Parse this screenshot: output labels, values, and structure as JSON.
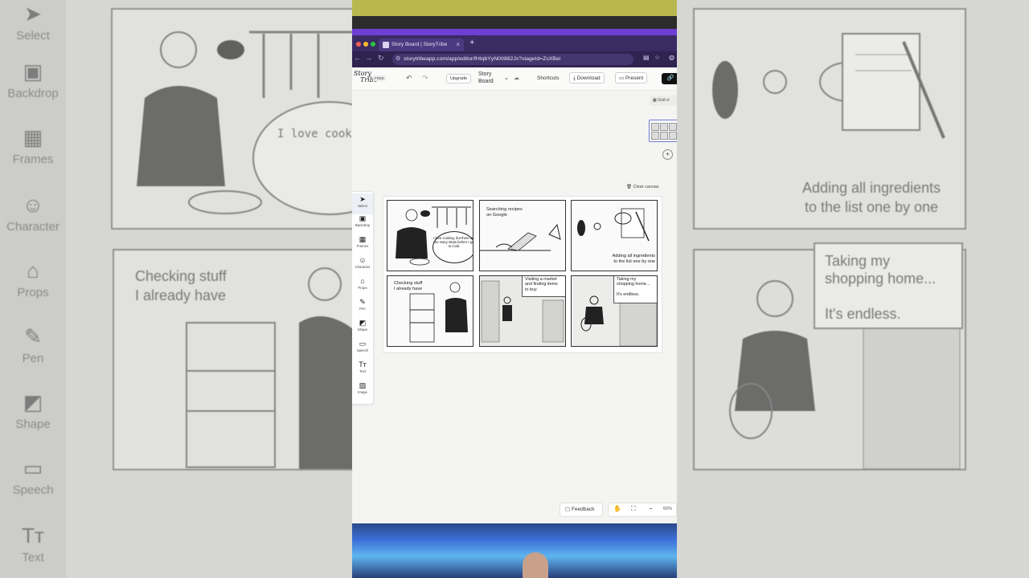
{
  "background_left": {
    "tools": [
      "Select",
      "Backdrop",
      "Frames",
      "Character",
      "Props",
      "Pen",
      "Shape",
      "Speech",
      "Text"
    ],
    "bubble_text": "I love cooking, but there are too many steps before I get to cook.",
    "panel_caption": "Checking stuff\nI already have"
  },
  "background_right": {
    "caption1": "Adding all ingredients\nto the list one by one",
    "caption2": "Taking my\nshopping home...\n\nIt's endless."
  },
  "browser": {
    "tab_title": "Story Board | StoryTribe",
    "url": "storytribeapp.com/app/editor/fHtqbYyNlXt882Jx?stageId=ZsXBei"
  },
  "header": {
    "logo_line1": "Story",
    "logo_line2": "Tribe",
    "free_badge": "FREE",
    "undo_icon": "undo-icon",
    "redo_icon": "redo-icon",
    "upgrade_label": "Upgrade",
    "doc_title": "Story\nBoard",
    "shortcuts_label": "Shortcuts",
    "download_label": "Download",
    "present_label": "Present"
  },
  "tools": [
    {
      "label": "Select",
      "icon": "cursor-icon",
      "glyph": "➤"
    },
    {
      "label": "Backdrop",
      "icon": "image-frame-icon",
      "glyph": "▣"
    },
    {
      "label": "Frames",
      "icon": "grid-icon",
      "glyph": "▦"
    },
    {
      "label": "Character",
      "icon": "face-icon",
      "glyph": "☺"
    },
    {
      "label": "Props",
      "icon": "sofa-icon",
      "glyph": "⌂"
    },
    {
      "label": "Pen",
      "icon": "pen-icon",
      "glyph": "✎"
    },
    {
      "label": "Shape",
      "icon": "shape-icon",
      "glyph": "◩"
    },
    {
      "label": "Speech",
      "icon": "speech-icon",
      "glyph": "▭"
    },
    {
      "label": "Text",
      "icon": "text-icon",
      "glyph": "Tт"
    },
    {
      "label": "Image",
      "icon": "photo-icon",
      "glyph": "▨"
    }
  ],
  "canvas": {
    "grid_view_label": "Grid vi",
    "clear_canvas_label": "Clear canvas",
    "panels": [
      {
        "caption": "",
        "bubble": "I love cooking, but there are too many steps before I get to cook."
      },
      {
        "caption": "Searching recipes\non Google"
      },
      {
        "caption": "Adding all ingredients\nto the list one by one"
      },
      {
        "caption": "Checking stuff\nI already have"
      },
      {
        "caption": "Visiting a market\nand finding items\nto buy"
      },
      {
        "caption": "Taking my\nshopping home...\n\nIt's endless."
      }
    ]
  },
  "bottom": {
    "feedback_label": "Feedback",
    "zoom_label": "60%"
  },
  "colors": {
    "accent": "#6d3fd3",
    "tabbar": "#3a2b63"
  }
}
